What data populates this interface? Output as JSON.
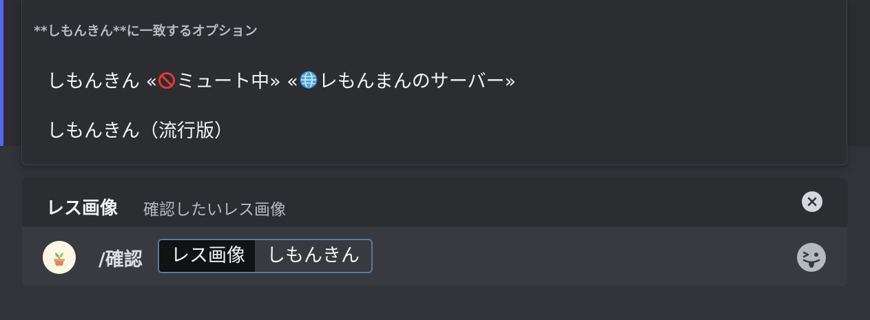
{
  "autocomplete": {
    "header": "**しもんきん**に一致するオプション",
    "items": [
      {
        "name": "しもんきん",
        "open_quote": "«",
        "badge1_text": "ミュート中",
        "mid_quote": "» «",
        "badge2_text": "レもんまんのサーバー",
        "close_quote": "»"
      },
      {
        "name": "しもんきん（流行版）"
      }
    ]
  },
  "option": {
    "name": "レス画像",
    "description": "確認したいレス画像"
  },
  "input": {
    "command": "/確認",
    "field_name": "レス画像",
    "field_value": "しもんきん"
  },
  "icons": {
    "close": "close-circle-icon",
    "emoji": "emoji-face-icon",
    "avatar": "potted-sprout-icon",
    "mute": "no-entry-icon",
    "globe": "globe-icon"
  },
  "colors": {
    "accent": "#5865f2",
    "field_border": "#4e7dae"
  }
}
